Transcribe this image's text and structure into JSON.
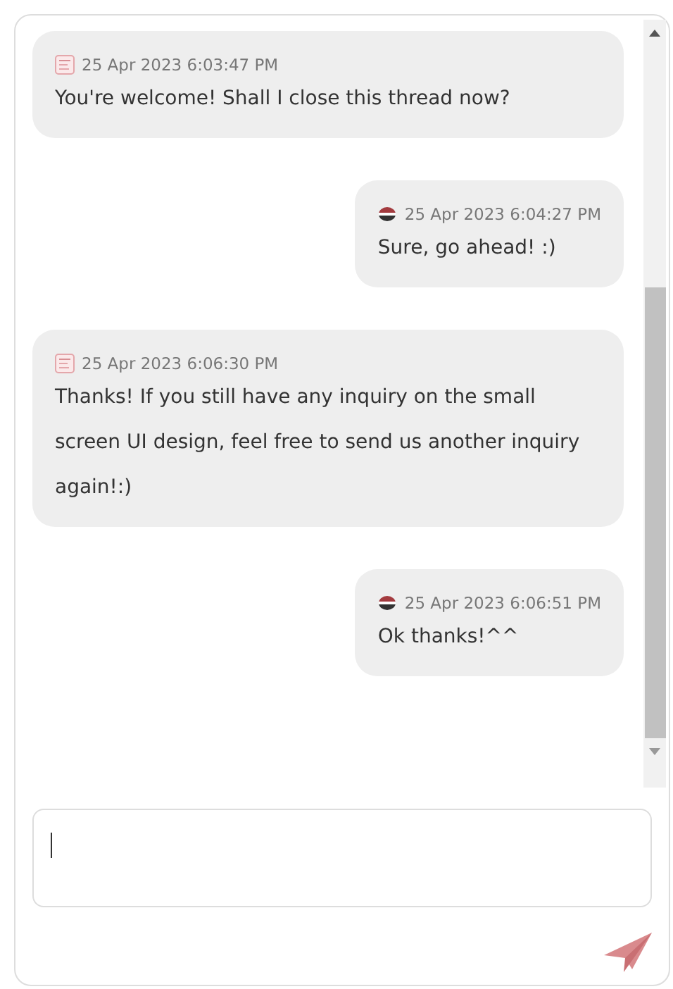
{
  "messages": [
    {
      "kind": "agent",
      "time": "25 Apr 2023 6:03:47 PM",
      "text": "You're welcome! Shall I close this thread now?"
    },
    {
      "kind": "user",
      "time": "25 Apr 2023 6:04:27 PM",
      "text": "Sure, go ahead! :)"
    },
    {
      "kind": "agent",
      "time": "25 Apr 2023 6:06:30 PM",
      "text": "Thanks! If you still have any inquiry on the small screen UI design, feel free to send us another inquiry again!:)"
    },
    {
      "kind": "user",
      "time": "25 Apr 2023 6:06:51 PM",
      "text": "Ok thanks!^^"
    }
  ]
}
